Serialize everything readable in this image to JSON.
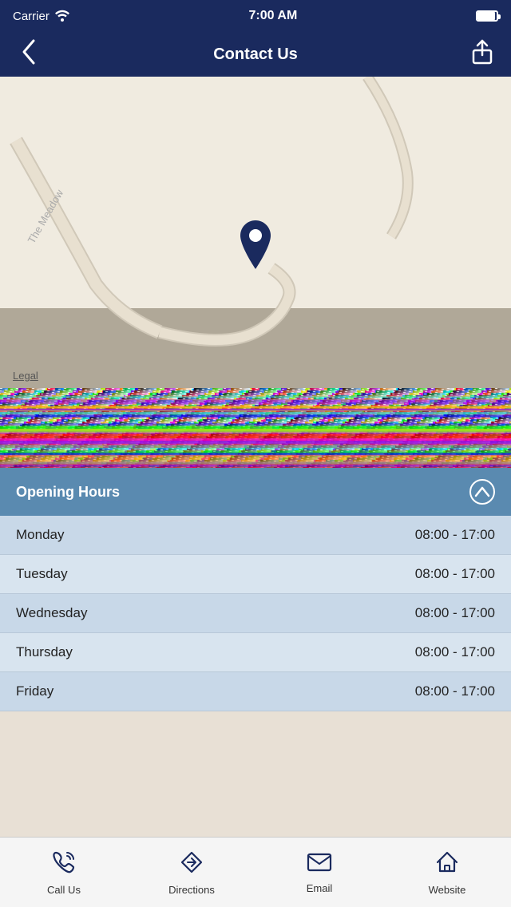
{
  "status": {
    "carrier": "Carrier",
    "time": "7:00 AM"
  },
  "nav": {
    "title": "Contact Us",
    "back_label": "‹",
    "share_label": "⬆"
  },
  "map": {
    "legal_label": "Legal",
    "road_label": "The Meadow"
  },
  "opening_hours": {
    "title": "Opening Hours",
    "chevron": "∧",
    "rows": [
      {
        "day": "Monday",
        "hours": "08:00 - 17:00"
      },
      {
        "day": "Tuesday",
        "hours": "08:00 - 17:00"
      },
      {
        "day": "Wednesday",
        "hours": "08:00 - 17:00"
      },
      {
        "day": "Thursday",
        "hours": "08:00 - 17:00"
      },
      {
        "day": "Friday",
        "hours": "08:00 - 17:00"
      }
    ]
  },
  "tabs": [
    {
      "id": "call",
      "label": "Call Us",
      "icon": "phone"
    },
    {
      "id": "directions",
      "label": "Directions",
      "icon": "directions"
    },
    {
      "id": "email",
      "label": "Email",
      "icon": "email"
    },
    {
      "id": "website",
      "label": "Website",
      "icon": "house"
    }
  ],
  "colors": {
    "nav_bg": "#1a2a5e",
    "accent": "#5a8ab0"
  }
}
